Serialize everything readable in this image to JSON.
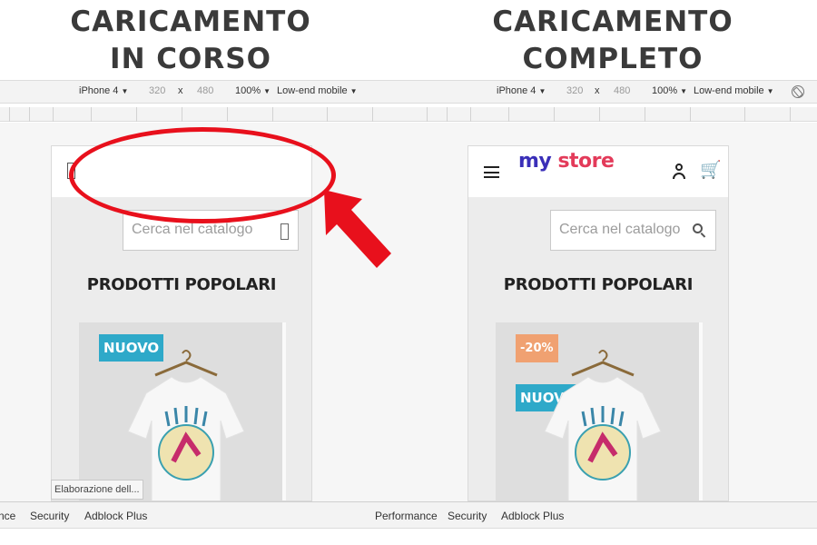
{
  "headings": {
    "left_line1": "CARICAMENTO",
    "left_line2": "IN CORSO",
    "right_line1": "CARICAMENTO",
    "right_line2": "COMPLETO"
  },
  "device_toolbar": {
    "left": {
      "device": "iPhone 4",
      "width": "320",
      "x": "x",
      "height": "480",
      "zoom": "100%",
      "throttle": "Low-end mobile"
    },
    "right": {
      "device": "iPhone 4",
      "width": "320",
      "x": "x",
      "height": "480",
      "zoom": "100%",
      "throttle": "Low-end mobile"
    }
  },
  "store": {
    "logo_my": "my",
    "logo_store": "store",
    "search_placeholder": "Cerca nel catalogo",
    "section_title": "PRODOTTI POPOLARI",
    "badge_new": "NUOVO",
    "badge_discount": "-20%"
  },
  "loading_tooltip": "Elaborazione dell...",
  "bottom_tabs": {
    "left": [
      "nce",
      "Security",
      "Adblock Plus"
    ],
    "right": [
      "Performance",
      "Security",
      "Adblock Plus"
    ]
  },
  "colors": {
    "annotation_red": "#e8101c",
    "badge_new": "#2ea9c9",
    "badge_discount": "#f0a171",
    "logo_blue": "#3a2fb8",
    "logo_pink": "#e33b5a"
  },
  "icons": [
    "broken-glyph-icon",
    "hamburger-menu-icon",
    "user-icon",
    "cart-icon",
    "search-icon",
    "rotate-icon"
  ]
}
